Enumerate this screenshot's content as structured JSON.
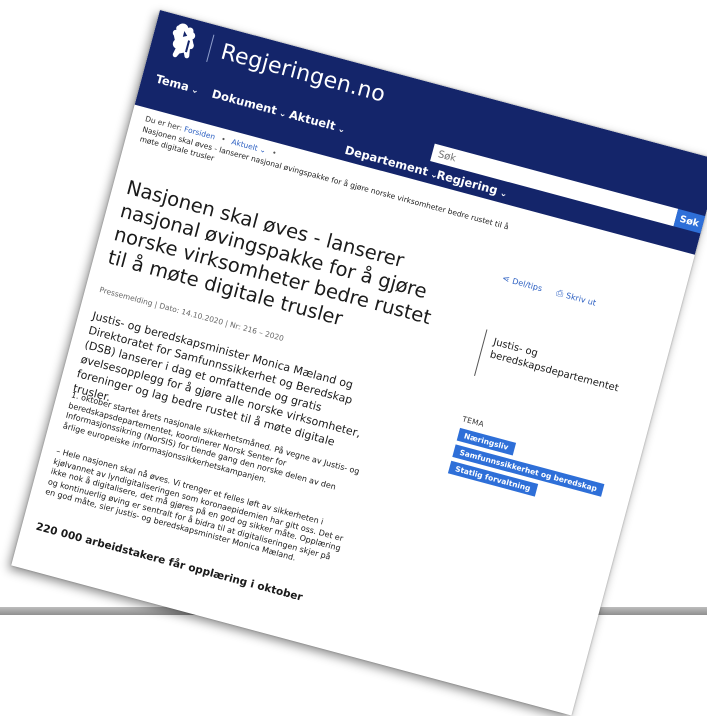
{
  "header": {
    "site_name": "Regjeringen.no",
    "nav": [
      {
        "label": "Tema"
      },
      {
        "label": "Dokument"
      },
      {
        "label": "Aktuelt"
      },
      {
        "label": "Departement"
      },
      {
        "label": "Regjering"
      }
    ],
    "search": {
      "placeholder": "Søk",
      "button_label": "Søk"
    }
  },
  "breadcrumb": {
    "prefix": "Du er her:",
    "items": [
      {
        "label": "Forsiden"
      },
      {
        "label": "Aktuelt"
      }
    ],
    "current": "Nasjonen skal øves - lanserer nasjonal øvingspakke for å gjøre norske virksomheter bedre rustet til å møte digitale trusler"
  },
  "actions": {
    "share_label": "Del/tips",
    "print_label": "Skriv ut"
  },
  "article": {
    "title": "Nasjonen skal øves - lanserer nasjonal øvingspakke for å gjøre norske virksomheter bedre rustet til å møte digitale trusler",
    "meta": "Pressemelding | Dato: 14.10.2020 | Nr: 216 – 2020",
    "lead": "Justis- og beredskapsminister Monica Mæland og Direktoratet for Samfunnssikkerhet og Beredskap (DSB) lanserer i dag et omfattende og gratis øvelsesopplegg for å gjøre alle norske virksomheter, foreninger og lag bedre rustet til å møte digitale trusler.",
    "paragraphs": [
      "1. oktober startet årets nasjonale sikkerhetsmåned. På vegne av Justis- og beredskapsdepartementet, koordinerer Norsk Senter for Informasjonssikring (NorSIS) for tiende gang den norske delen av den årlige europeiske informasjonssikkerhetskampanjen.",
      "– Hele nasjonen skal nå øves. Vi trenger et felles løft av sikkerheten i kjølvannet av lyndigitaliseringen som koronaepidemien har gitt oss. Det er ikke nok å digitalisere, det må gjøres på en god og sikker måte. Opplæring og kontinuerlig øving er sentralt for å bidra til at digitaliseringen skjer på en god måte, sier justis- og beredskapsminister Monica Mæland."
    ],
    "subheading": "220 000 arbeidstakere får opplæring i oktober"
  },
  "sidebar": {
    "department": "Justis- og beredskapsdepartementet",
    "tema_label": "TEMA",
    "tags": [
      {
        "label": "Næringsliv"
      },
      {
        "label": "Samfunnssikkerhet og beredskap"
      },
      {
        "label": "Statlig forvaltning"
      }
    ]
  },
  "colors": {
    "header_bg": "#14256a",
    "accent": "#2e6fd8",
    "link": "#2b5fc2"
  }
}
